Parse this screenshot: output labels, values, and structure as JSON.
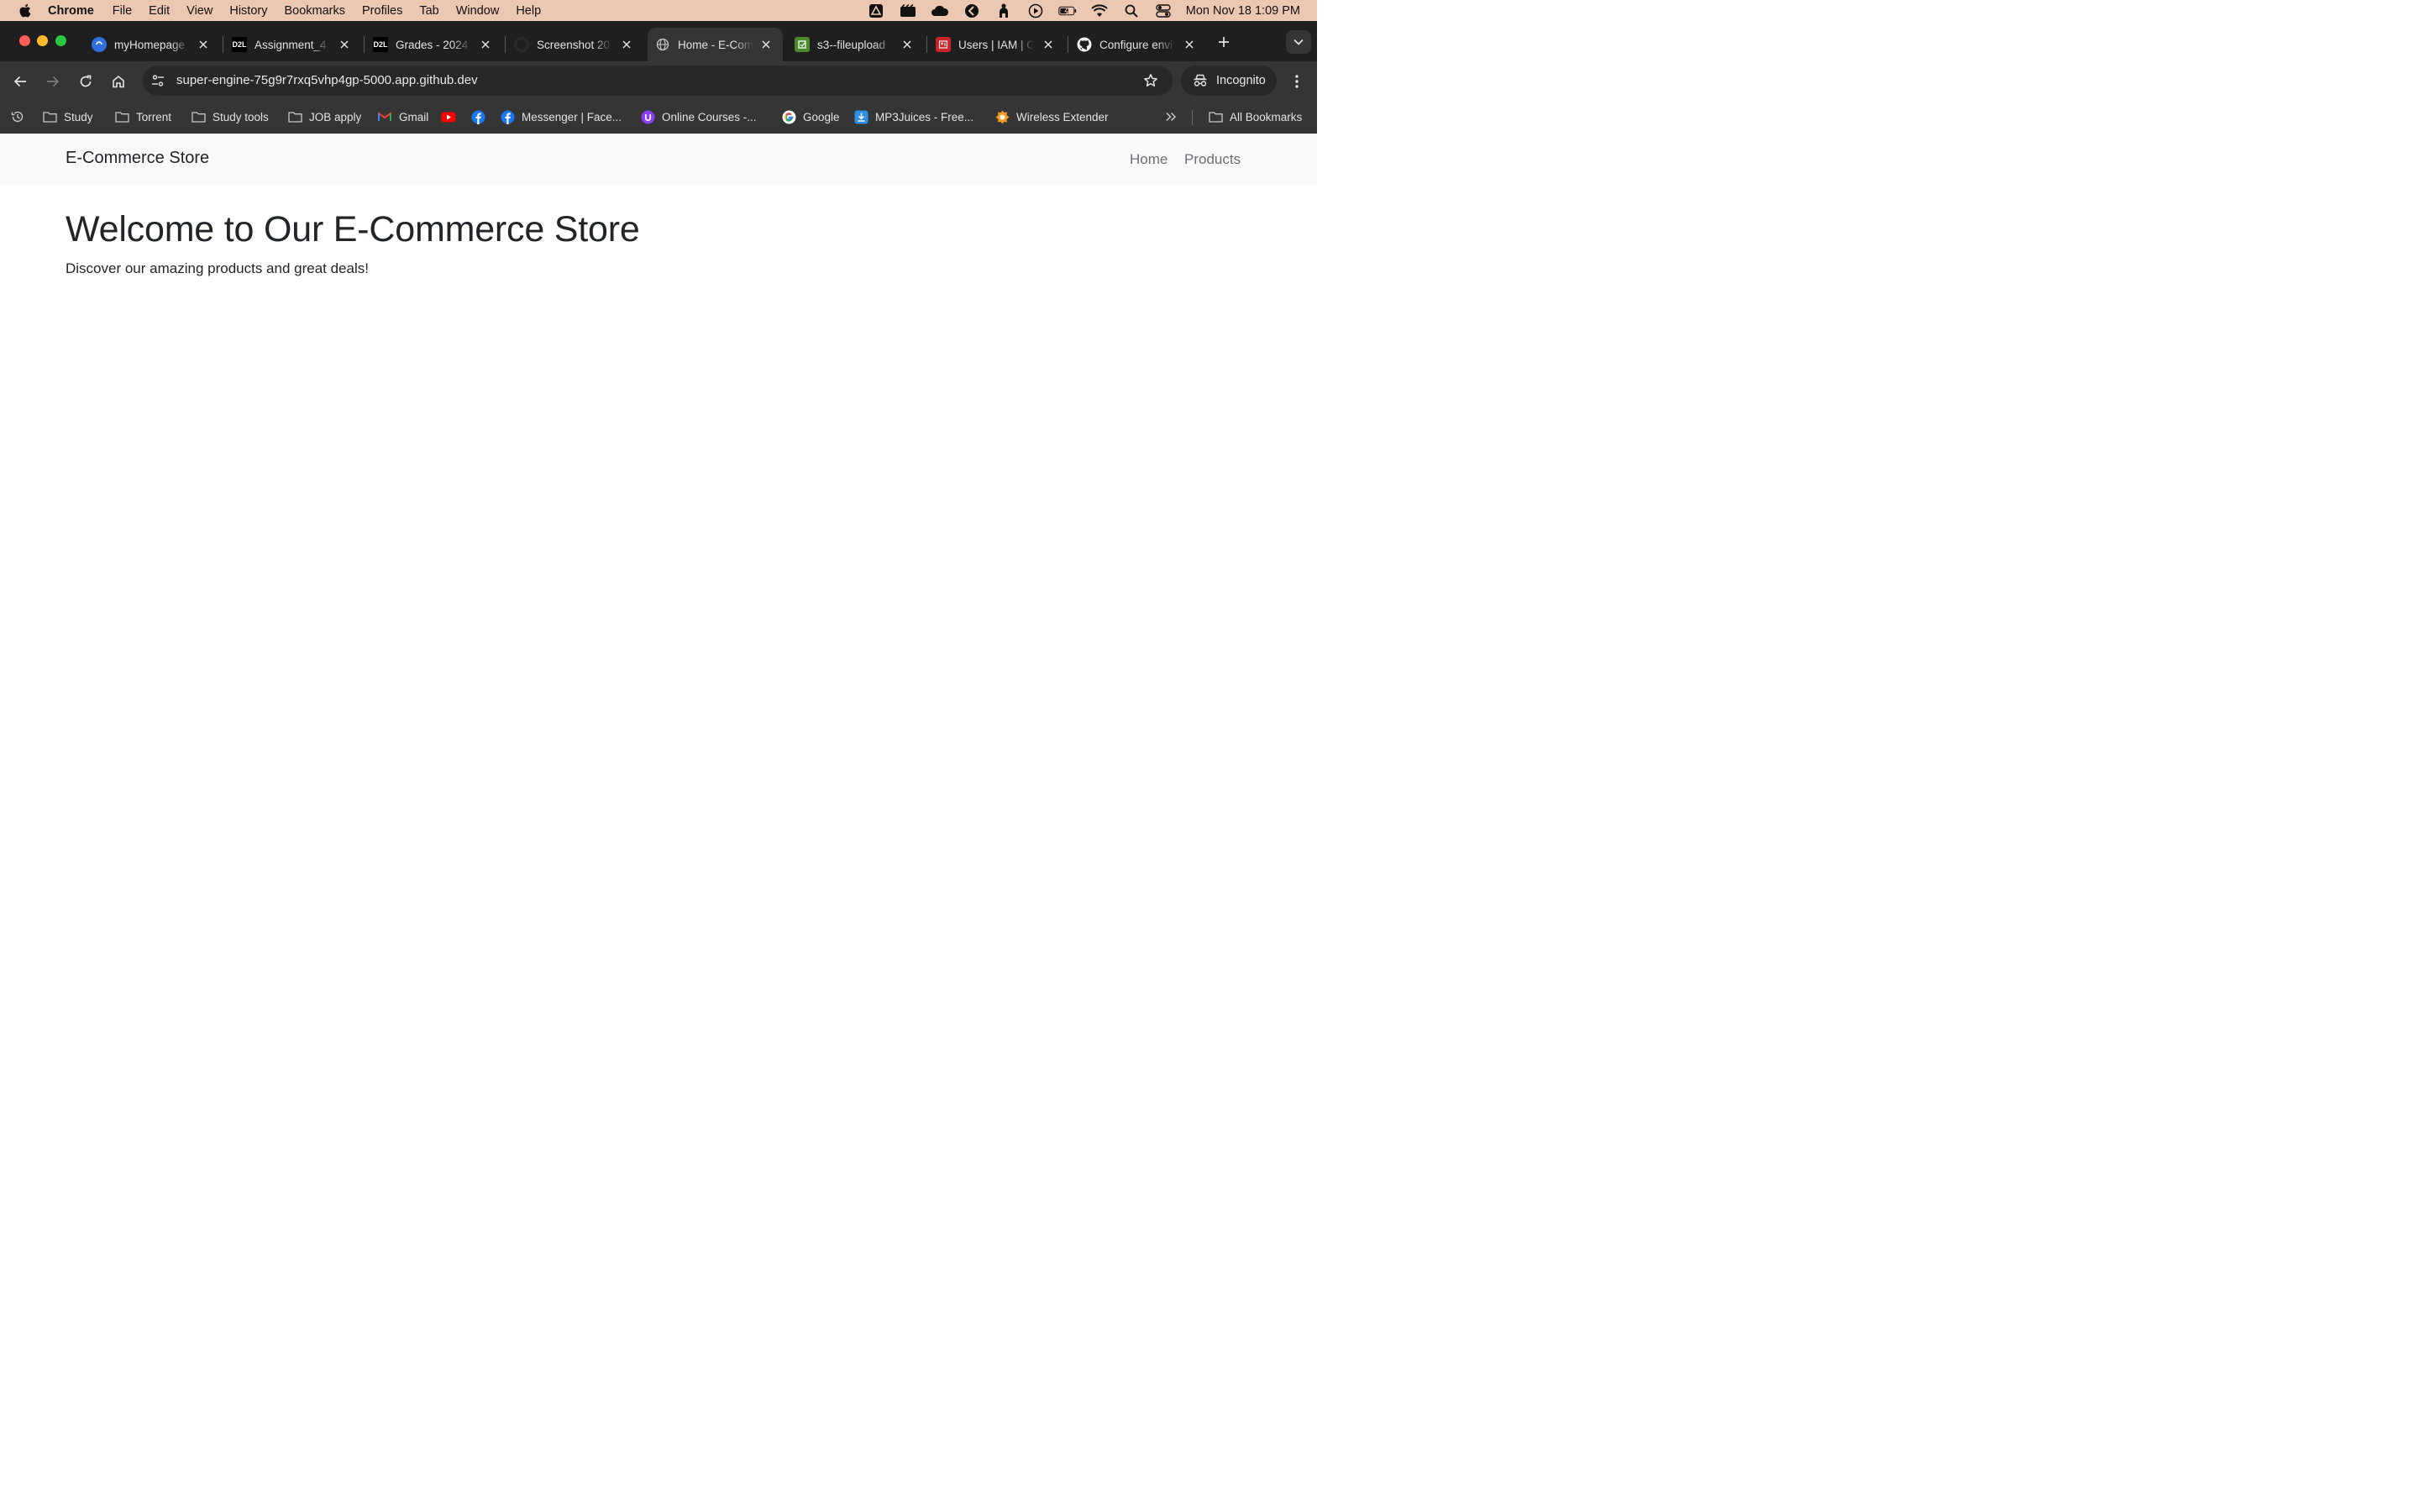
{
  "menubar": {
    "app_name": "Chrome",
    "items": [
      "File",
      "Edit",
      "View",
      "History",
      "Bookmarks",
      "Profiles",
      "Tab",
      "Window",
      "Help"
    ],
    "clock": "Mon Nov 18  1:09 PM"
  },
  "tabs": [
    {
      "title": "myHomepage",
      "icon": "website-icon"
    },
    {
      "title": "Assignment_4",
      "icon": "d2l-icon"
    },
    {
      "title": "Grades - 2024",
      "icon": "d2l-icon"
    },
    {
      "title": "Screenshot 20",
      "icon": "github-icon"
    },
    {
      "title": "Home - E-Com",
      "icon": "globe-icon",
      "active": true
    },
    {
      "title": "s3--fileupload",
      "icon": "s3-icon"
    },
    {
      "title": "Users | IAM | G",
      "icon": "iam-icon"
    },
    {
      "title": "Configure envi",
      "icon": "github-icon"
    }
  ],
  "toolbar": {
    "url": "super-engine-75g9r7rxq5vhp4gp-5000.app.github.dev",
    "incognito_label": "Incognito"
  },
  "bookmarks": {
    "items": [
      "Study",
      "Torrent",
      "Study tools",
      "JOB apply",
      "Gmail",
      "",
      "",
      "Messenger | Face...",
      "Online Courses -...",
      "Google",
      "MP3Juices - Free...",
      "Wireless Extender"
    ],
    "all_bookmarks": "All Bookmarks"
  },
  "page": {
    "brand": "E-Commerce Store",
    "nav": {
      "home": "Home",
      "products": "Products"
    },
    "hero_title": "Welcome to Our E-Commerce Store",
    "hero_subtitle": "Discover our amazing products and great deals!"
  },
  "colors": {
    "menubar_bg": "#ecc7b2",
    "chrome_dark": "#1f1f1f",
    "toolbar": "#353535",
    "navbar_bg": "#f8f9fa",
    "text_dark": "#212529"
  }
}
